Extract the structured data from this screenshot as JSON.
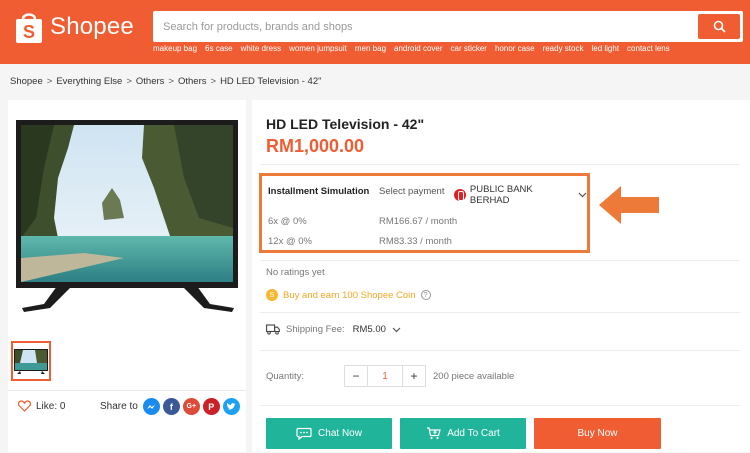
{
  "header": {
    "brand": "Shopee",
    "search_placeholder": "Search for products, brands and shops",
    "keywords": [
      "makeup bag",
      "6s case",
      "white dress",
      "women jumpsuit",
      "men bag",
      "android cover",
      "car sticker",
      "honor case",
      "ready stock",
      "led light",
      "contact lens"
    ],
    "colors": {
      "brand": "#f05d32"
    }
  },
  "breadcrumb": [
    "Shopee",
    "Everything Else",
    "Others",
    "Others",
    "HD LED Television - 42\""
  ],
  "product": {
    "title": "HD LED Television - 42\"",
    "price": "RM1,000.00",
    "installment": {
      "title": "Installment Simulation",
      "select_label": "Select payment",
      "bank": "PUBLIC BANK BERHAD",
      "plans": [
        {
          "term": "6x @ 0%",
          "amount": "RM166.67 / month"
        },
        {
          "term": "12x @ 0%",
          "amount": "RM83.33 / month"
        }
      ]
    },
    "rating_text": "No ratings yet",
    "coin_text": "Buy and earn 100 Shopee Coin",
    "shipping_label": "Shipping Fee:",
    "shipping_value": "RM5.00",
    "quantity_label": "Quantity:",
    "quantity_value": "1",
    "available": "200 piece available"
  },
  "social": {
    "like_text": "Like: 0",
    "share_label": "Share to",
    "share_icons": [
      "messenger-icon",
      "facebook-icon",
      "google-plus-icon",
      "pinterest-icon",
      "twitter-icon"
    ]
  },
  "buttons": {
    "chat": "Chat Now",
    "cart": "Add To Cart",
    "buy": "Buy Now"
  }
}
